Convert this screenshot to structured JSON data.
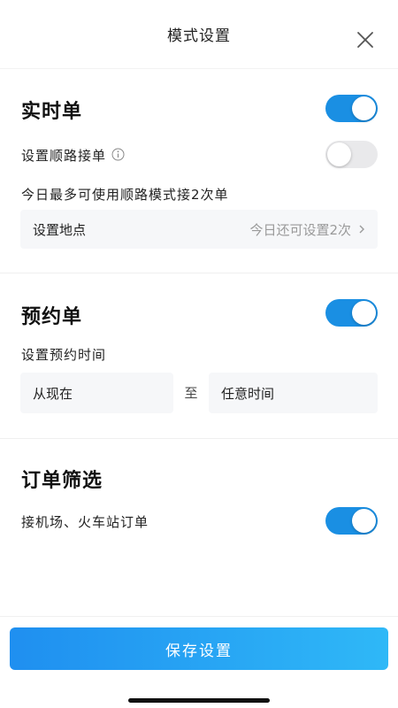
{
  "header": {
    "title": "模式设置"
  },
  "realtime": {
    "title": "实时单",
    "enabled": true,
    "route_label": "设置顺路接单",
    "route_enabled": false,
    "route_limit_text": "今日最多可使用顺路模式接2次单",
    "location_label": "设置地点",
    "location_remaining": "今日还可设置2次"
  },
  "reservation": {
    "title": "预约单",
    "enabled": true,
    "time_label": "设置预约时间",
    "from": "从现在",
    "to_label": "至",
    "to": "任意时间"
  },
  "filter": {
    "title": "订单筛选",
    "airport_label": "接机场、火车站订单",
    "airport_enabled": true
  },
  "footer": {
    "save_label": "保存设置"
  },
  "colors": {
    "accent": "#1a8fe3",
    "toggle_off": "#e9e9eb"
  }
}
